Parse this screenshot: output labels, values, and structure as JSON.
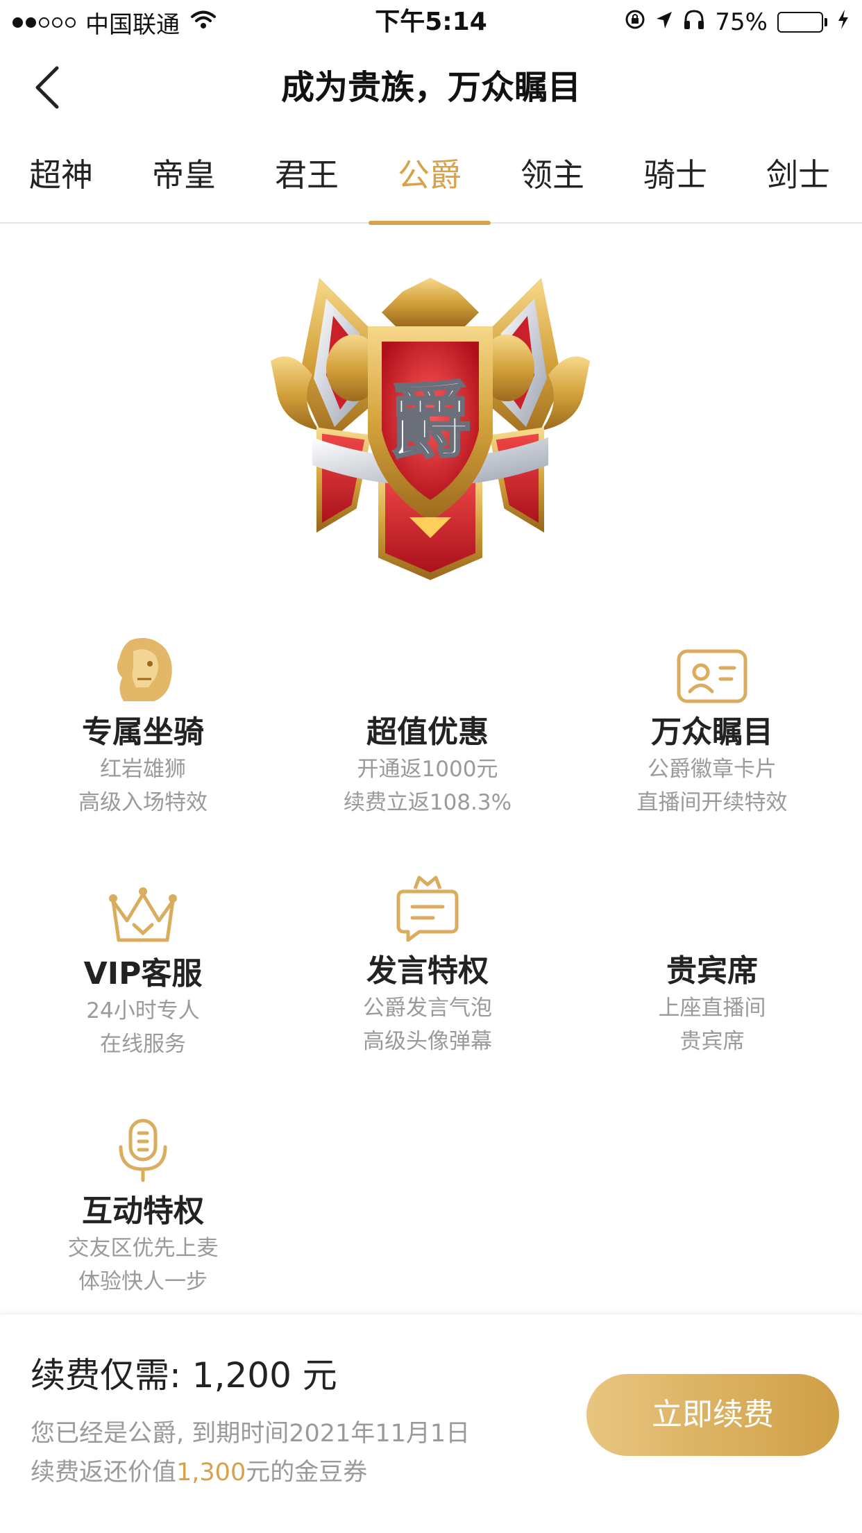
{
  "status_bar": {
    "carrier": "中国联通",
    "time": "下午5:14",
    "battery_percent": "75%",
    "battery_level": 0.75
  },
  "nav": {
    "title": "成为贵族，万众瞩目"
  },
  "tabs": [
    {
      "label": "超神"
    },
    {
      "label": "帝皇"
    },
    {
      "label": "君王"
    },
    {
      "label": "公爵",
      "active": true
    },
    {
      "label": "领主"
    },
    {
      "label": "骑士"
    },
    {
      "label": "剑士"
    }
  ],
  "emblem": {
    "character": "爵"
  },
  "benefits": [
    {
      "icon": "lion-icon",
      "title": "专属坐骑",
      "lines": [
        "红岩雄狮",
        "高级入场特效"
      ]
    },
    {
      "icon": "",
      "title": "超值优惠",
      "lines": [
        "开通返1000元",
        "续费立返108.3%"
      ]
    },
    {
      "icon": "id-card-icon",
      "title": "万众瞩目",
      "lines": [
        "公爵徽章卡片",
        "直播间开续特效"
      ]
    },
    {
      "icon": "crown-icon",
      "title": "VIP客服",
      "lines": [
        "24小时专人",
        "在线服务"
      ]
    },
    {
      "icon": "chat-bubble-crown-icon",
      "title": "发言特权",
      "lines": [
        "公爵发言气泡",
        "高级头像弹幕"
      ]
    },
    {
      "icon": "",
      "title": "贵宾席",
      "lines": [
        "上座直播间",
        "贵宾席"
      ]
    },
    {
      "icon": "microphone-icon",
      "title": "互动特权",
      "lines": [
        "交友区优先上麦",
        "体验快人一步"
      ]
    }
  ],
  "bottom": {
    "price_label": "续费仅需:",
    "price_value": "1,200 元",
    "info_line1": "您已经是公爵, 到期时间2021年11月1日",
    "info_line2_prefix": "续费返还价值",
    "info_line2_amount": "1,300",
    "info_line2_suffix": "元的金豆券",
    "renew_label": "立即续费"
  },
  "colors": {
    "accent": "#d7a248",
    "text": "#222222",
    "muted": "#9a9a9a"
  }
}
